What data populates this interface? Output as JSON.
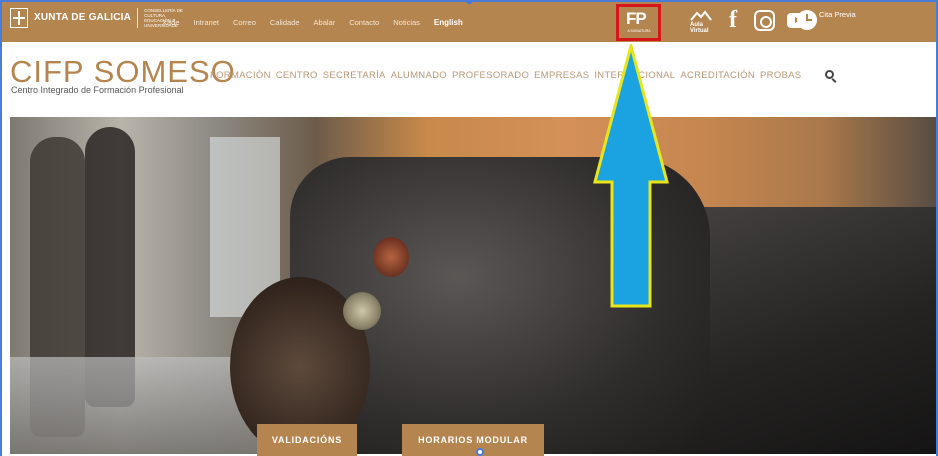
{
  "topbar": {
    "xunta_name": "XUNTA DE GALICIA",
    "xunta_conselleria": "CONSELLERÍA DE CULTURA, EDUCACIÓN E UNIVERSIDADE",
    "links": [
      "Xade",
      "Intranet",
      "Correo",
      "Calidade",
      "Abalar",
      "Contacto",
      "Noticias"
    ],
    "english_label": "English",
    "fp_logo": "FP",
    "fp_sub": "A SIGNATURA",
    "aula_virtual": "Aula Virtual",
    "facebook_glyph": "f",
    "cita_previa": "Cita Previa"
  },
  "header": {
    "brand": "CIFP SOMESO",
    "subtitle": "Centro Integrado de Formación Profesional",
    "nav": [
      "FORMACIÓN",
      "CENTRO",
      "SECRETARÍA",
      "ALUMNADO",
      "PROFESORADO",
      "EMPRESAS",
      "INTERNACIONAL",
      "ACREDITACIÓN",
      "PROBAS"
    ]
  },
  "hero": {
    "buttons": [
      "VALIDACIÓNS",
      "HORARIOS MODULAR"
    ]
  },
  "colors": {
    "brand": "#b58550",
    "highlight": "#d6161a",
    "arrow_fill": "#1aa3e0",
    "arrow_stroke": "#e8e61a"
  },
  "icons": [
    "xunta-logo-icon",
    "fp-logo-icon",
    "aula-virtual-icon",
    "facebook-icon",
    "instagram-icon",
    "youtube-icon",
    "clock-icon",
    "search-icon",
    "annotation-arrow-icon"
  ]
}
